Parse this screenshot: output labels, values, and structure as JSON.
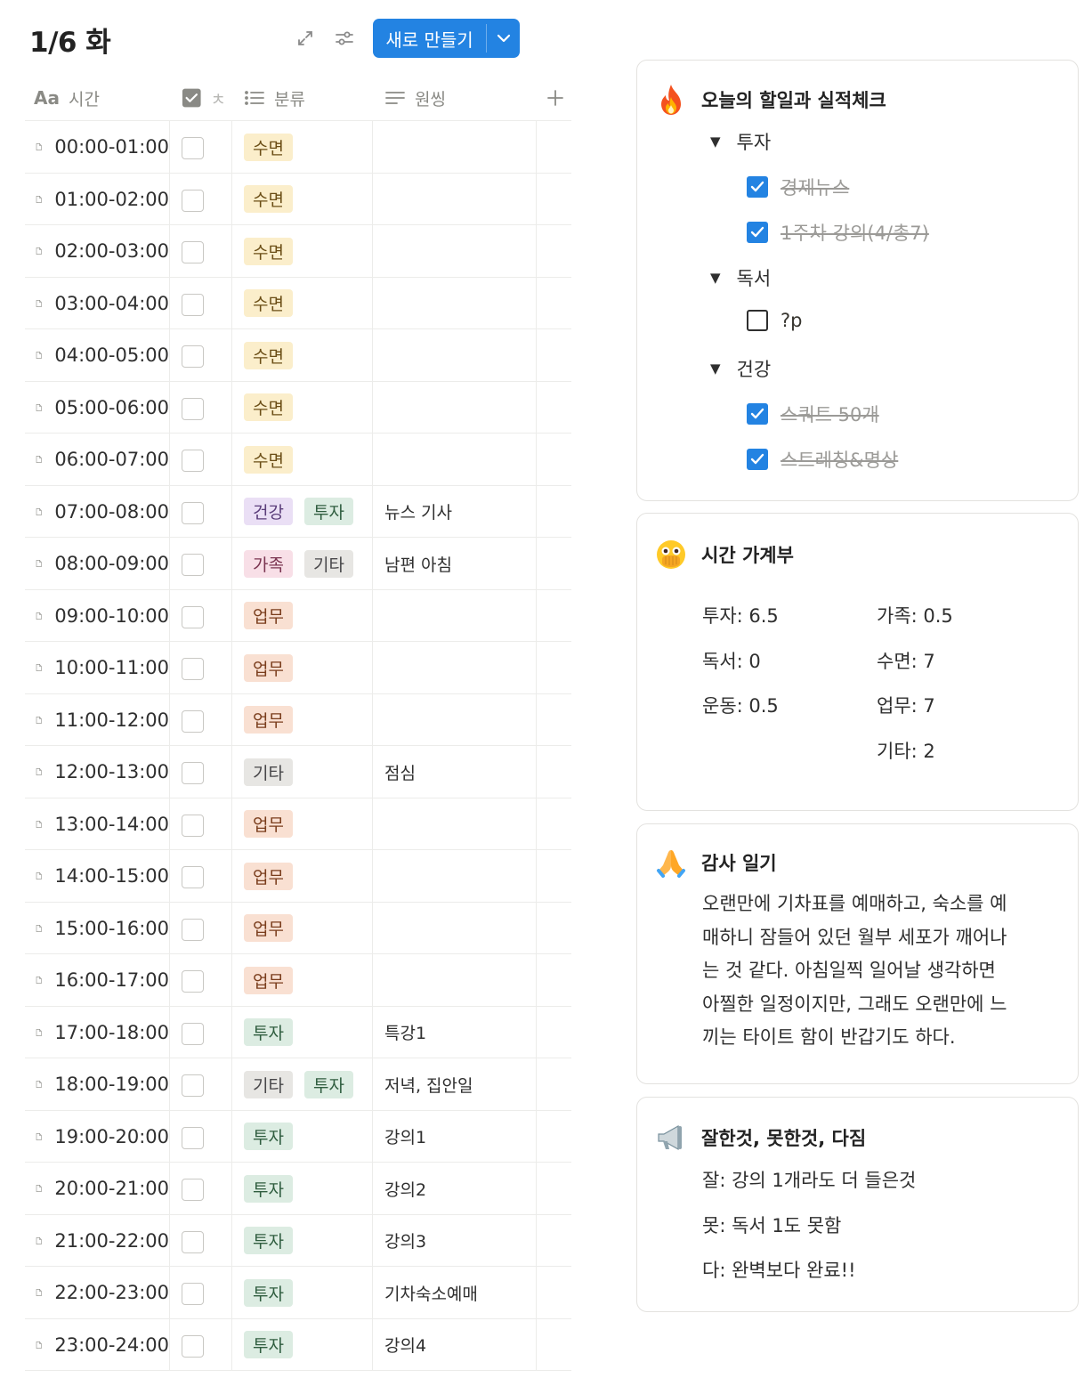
{
  "header": {
    "title": "1/6 화",
    "new_button_label": "새로 만들기"
  },
  "table": {
    "columns": {
      "time": "시간",
      "check": "ㅊ",
      "category": "분류",
      "source": "원씽"
    },
    "rows": [
      {
        "time": "00:00-01:00",
        "tags": [
          {
            "label": "수면",
            "color": "yellow"
          }
        ],
        "note": ""
      },
      {
        "time": "01:00-02:00",
        "tags": [
          {
            "label": "수면",
            "color": "yellow"
          }
        ],
        "note": ""
      },
      {
        "time": "02:00-03:00",
        "tags": [
          {
            "label": "수면",
            "color": "yellow"
          }
        ],
        "note": ""
      },
      {
        "time": "03:00-04:00",
        "tags": [
          {
            "label": "수면",
            "color": "yellow"
          }
        ],
        "note": ""
      },
      {
        "time": "04:00-05:00",
        "tags": [
          {
            "label": "수면",
            "color": "yellow"
          }
        ],
        "note": ""
      },
      {
        "time": "05:00-06:00",
        "tags": [
          {
            "label": "수면",
            "color": "yellow"
          }
        ],
        "note": ""
      },
      {
        "time": "06:00-07:00",
        "tags": [
          {
            "label": "수면",
            "color": "yellow"
          }
        ],
        "note": ""
      },
      {
        "time": "07:00-08:00",
        "tags": [
          {
            "label": "건강",
            "color": "purple"
          },
          {
            "label": "투자",
            "color": "green"
          }
        ],
        "note": "뉴스 기사"
      },
      {
        "time": "08:00-09:00",
        "tags": [
          {
            "label": "가족",
            "color": "pink"
          },
          {
            "label": "기타",
            "color": "gray"
          }
        ],
        "note": "남편 아침"
      },
      {
        "time": "09:00-10:00",
        "tags": [
          {
            "label": "업무",
            "color": "orange"
          }
        ],
        "note": ""
      },
      {
        "time": "10:00-11:00",
        "tags": [
          {
            "label": "업무",
            "color": "orange"
          }
        ],
        "note": ""
      },
      {
        "time": "11:00-12:00",
        "tags": [
          {
            "label": "업무",
            "color": "orange"
          }
        ],
        "note": ""
      },
      {
        "time": "12:00-13:00",
        "tags": [
          {
            "label": "기타",
            "color": "gray"
          }
        ],
        "note": "점심"
      },
      {
        "time": "13:00-14:00",
        "tags": [
          {
            "label": "업무",
            "color": "orange"
          }
        ],
        "note": ""
      },
      {
        "time": "14:00-15:00",
        "tags": [
          {
            "label": "업무",
            "color": "orange"
          }
        ],
        "note": ""
      },
      {
        "time": "15:00-16:00",
        "tags": [
          {
            "label": "업무",
            "color": "orange"
          }
        ],
        "note": ""
      },
      {
        "time": "16:00-17:00",
        "tags": [
          {
            "label": "업무",
            "color": "orange"
          }
        ],
        "note": ""
      },
      {
        "time": "17:00-18:00",
        "tags": [
          {
            "label": "투자",
            "color": "green"
          }
        ],
        "note": "특강1"
      },
      {
        "time": "18:00-19:00",
        "tags": [
          {
            "label": "기타",
            "color": "gray"
          },
          {
            "label": "투자",
            "color": "green"
          }
        ],
        "note": "저녁, 집안일"
      },
      {
        "time": "19:00-20:00",
        "tags": [
          {
            "label": "투자",
            "color": "green"
          }
        ],
        "note": "강의1"
      },
      {
        "time": "20:00-21:00",
        "tags": [
          {
            "label": "투자",
            "color": "green"
          }
        ],
        "note": "강의2"
      },
      {
        "time": "21:00-22:00",
        "tags": [
          {
            "label": "투자",
            "color": "green"
          }
        ],
        "note": "강의3"
      },
      {
        "time": "22:00-23:00",
        "tags": [
          {
            "label": "투자",
            "color": "green"
          }
        ],
        "note": "기차숙소예매"
      },
      {
        "time": "23:00-24:00",
        "tags": [
          {
            "label": "투자",
            "color": "green"
          }
        ],
        "note": "강의4"
      }
    ]
  },
  "tag_colors": {
    "yellow": {
      "bg": "#fbeecb",
      "fg": "#6b4e16"
    },
    "purple": {
      "bg": "#eadff5",
      "fg": "#5a3d7a"
    },
    "green": {
      "bg": "#dcece2",
      "fg": "#2f5d3f"
    },
    "pink": {
      "bg": "#f8dfe7",
      "fg": "#7a3450"
    },
    "gray": {
      "bg": "#e7e6e3",
      "fg": "#48474a"
    },
    "orange": {
      "bg": "#f9e0d2",
      "fg": "#7a3d1c"
    }
  },
  "accent": "#2383e2",
  "todo_card": {
    "icon": "fire-icon",
    "title": "오늘의 할일과 실적체크",
    "groups": [
      {
        "label": "투자",
        "items": [
          {
            "text": "경제뉴스",
            "done": true
          },
          {
            "text": "1주차 강의(4/총7)",
            "done": true
          }
        ]
      },
      {
        "label": "독서",
        "items": [
          {
            "text": "?p",
            "done": false
          }
        ]
      },
      {
        "label": "건강",
        "items": [
          {
            "text": "스쿼트 50개",
            "done": true
          },
          {
            "text": "스트레칭&명상",
            "done": true
          }
        ]
      }
    ]
  },
  "time_card": {
    "icon": "face-with-open-eyes-and-hand-over-mouth-icon",
    "title": "시간 가계부",
    "left": [
      "투자: 6.5",
      "독서: 0",
      "운동: 0.5"
    ],
    "right": [
      "가족: 0.5",
      "수면: 7",
      "업무: 7",
      "기타: 2"
    ]
  },
  "gratitude_card": {
    "icon": "folded-hands-icon",
    "title": "감사 일기",
    "lines": [
      "오랜만에 기차표를 예매하고, 숙소를 예",
      "매하니 잠들어 있던 월부 세포가 깨어나",
      "는 것 같다. 아침일찍 일어날 생각하면",
      "아찔한 일정이지만, 그래도 오랜만에 느",
      "끼는 타이트 함이 반갑기도 하다."
    ]
  },
  "review_card": {
    "icon": "megaphone-icon",
    "title": "잘한것, 못한것, 다짐",
    "lines": [
      "잘: 강의 1개라도 더 들은것",
      "못: 독서 1도 못함",
      "다: 완벽보다 완료!!"
    ]
  }
}
